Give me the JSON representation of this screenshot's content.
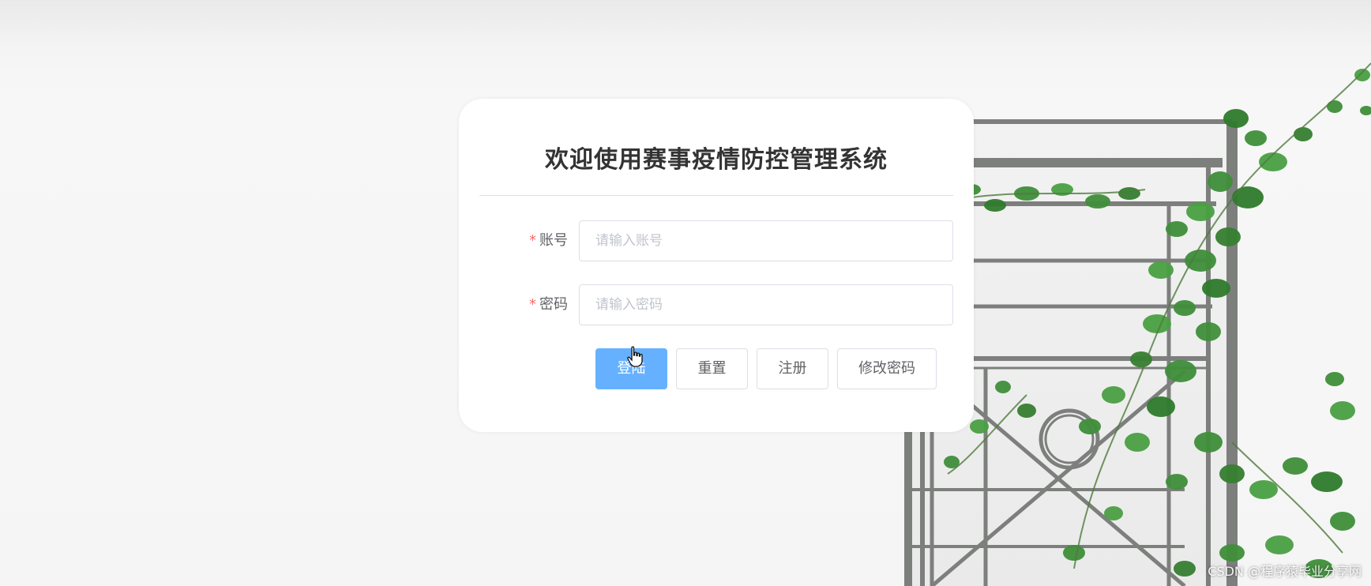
{
  "login": {
    "title": "欢迎使用赛事疫情防控管理系统",
    "account": {
      "label": "账号",
      "required": "*",
      "placeholder": "请输入账号",
      "value": ""
    },
    "password": {
      "label": "密码",
      "required": "*",
      "placeholder": "请输入密码",
      "value": ""
    },
    "buttons": {
      "login": "登陆",
      "reset": "重置",
      "register": "注册",
      "change_password": "修改密码"
    }
  },
  "watermark": "CSDN @程序猿毕业分享网",
  "colors": {
    "primary_button": "#66b1ff",
    "required": "#f56c6c",
    "title": "#333333",
    "border": "#dcdfe6",
    "ivy": "#3f8f3a",
    "window_frame": "#7d7f7d"
  },
  "icons": {
    "cursor": "hand-pointer-icon"
  }
}
